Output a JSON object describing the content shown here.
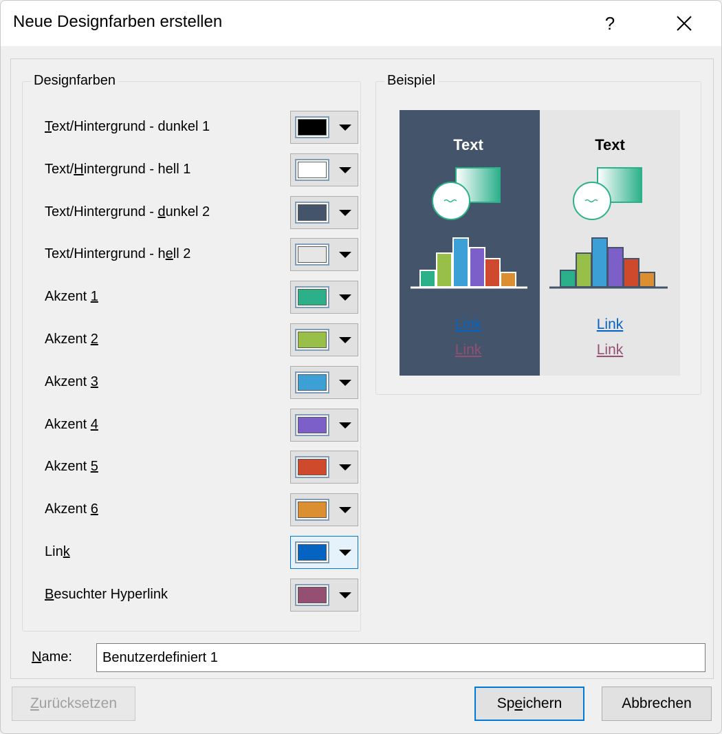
{
  "dialog": {
    "title": "Neue Designfarben erstellen",
    "help_label": "?",
    "close_label": "×"
  },
  "design_colors": {
    "legend": "Designfarben",
    "items": [
      {
        "pre": "",
        "key": "T",
        "post": "ext/Hintergrund - dunkel 1",
        "color": "#000000"
      },
      {
        "pre": "Text/",
        "key": "H",
        "post": "intergrund - hell 1",
        "color": "#ffffff"
      },
      {
        "pre": "Text/Hintergrund - ",
        "key": "d",
        "post": "unkel 2",
        "color": "#44546a"
      },
      {
        "pre": "Text/Hintergrund - h",
        "key": "e",
        "post": "ll 2",
        "color": "#e7e6e6"
      },
      {
        "pre": "Akzent ",
        "key": "1",
        "post": "",
        "color": "#2bb08a"
      },
      {
        "pre": "Akzent ",
        "key": "2",
        "post": "",
        "color": "#98c048"
      },
      {
        "pre": "Akzent ",
        "key": "3",
        "post": "",
        "color": "#3c9fd6"
      },
      {
        "pre": "Akzent ",
        "key": "4",
        "post": "",
        "color": "#7d5fca"
      },
      {
        "pre": "Akzent ",
        "key": "5",
        "post": "",
        "color": "#cf4a2d"
      },
      {
        "pre": "Akzent ",
        "key": "6",
        "post": "",
        "color": "#dc8f30"
      },
      {
        "pre": "Lin",
        "key": "k",
        "post": "",
        "color": "#0563c1"
      },
      {
        "pre": "",
        "key": "B",
        "post": "esuchter Hyperlink",
        "color": "#954f72"
      }
    ]
  },
  "example": {
    "legend": "Beispiel",
    "dark_panel": {
      "text": "Text",
      "link": "Link",
      "visited": "Link"
    },
    "light_panel": {
      "text": "Text",
      "link": "Link",
      "visited": "Link"
    }
  },
  "name_field": {
    "label_key": "N",
    "label_rest": "ame:",
    "value": "Benutzerdefiniert 1"
  },
  "buttons": {
    "reset_key": "Z",
    "reset_rest": "urücksetzen",
    "save_pre": "Sp",
    "save_key": "e",
    "save_post": "ichern",
    "cancel": "Abbrechen"
  }
}
